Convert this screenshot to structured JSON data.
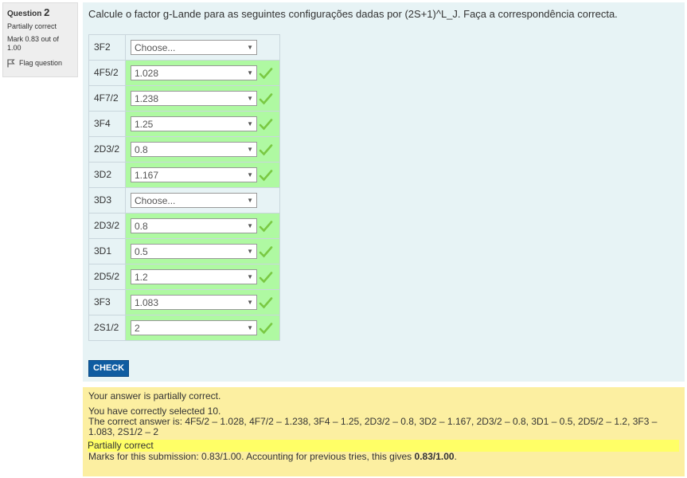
{
  "info": {
    "question_label": "Question",
    "question_number": "2",
    "state": "Partially correct",
    "grade": "Mark 0.83 out of 1.00",
    "flag_label": "Flag question"
  },
  "question": {
    "text": "Calcule o factor g-Lande para as seguintes configurações dadas por (2S+1)^L_J. Faça a correspondência correcta.",
    "rows": [
      {
        "label": "3F2",
        "value": "Choose...",
        "correct": false
      },
      {
        "label": "4F5/2",
        "value": "1.028",
        "correct": true
      },
      {
        "label": "4F7/2",
        "value": "1.238",
        "correct": true
      },
      {
        "label": "3F4",
        "value": "1.25",
        "correct": true
      },
      {
        "label": "2D3/2",
        "value": "0.8",
        "correct": true
      },
      {
        "label": "3D2",
        "value": "1.167",
        "correct": true
      },
      {
        "label": "3D3",
        "value": "Choose...",
        "correct": false
      },
      {
        "label": "2D3/2",
        "value": "0.8",
        "correct": true
      },
      {
        "label": "3D1",
        "value": "0.5",
        "correct": true
      },
      {
        "label": "2D5/2",
        "value": "1.2",
        "correct": true
      },
      {
        "label": "3F3",
        "value": "1.083",
        "correct": true
      },
      {
        "label": "2S1/2",
        "value": "2",
        "correct": true
      }
    ],
    "check_label": "CHECK"
  },
  "feedback": {
    "line1": "Your answer is partially correct.",
    "line2": "You have correctly selected 10.",
    "line3": "The correct answer is: 4F5/2 – 1.028, 4F7/2 – 1.238, 3F4 – 1.25, 2D3/2 – 0.8, 3D2 – 1.167, 2D3/2 – 0.8, 3D1 – 0.5, 2D5/2 – 1.2, 3F3 – 1.083, 2S1/2 – 2",
    "partial_label": "Partially correct",
    "marks_text": "Marks for this submission: 0.83/1.00. Accounting for previous tries, this gives ",
    "marks_bold": "0.83/1.00",
    "marks_end": "."
  },
  "colors": {
    "correct_bg": "#aff9a2",
    "formulation_bg": "#e7f3f5",
    "outcome_bg": "#fcefa1",
    "button_bg": "#0f5ca1",
    "tick": "#7ac943"
  }
}
